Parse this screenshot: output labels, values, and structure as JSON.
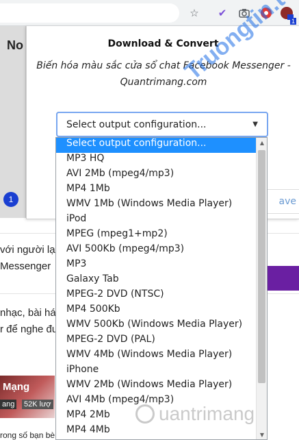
{
  "toolbar": {
    "icons": [
      "star-icon",
      "extension-check-icon",
      "camera-icon",
      "record-icon",
      "profile-icon"
    ],
    "ext_badge": "1"
  },
  "background": {
    "side_title": "No",
    "badge": "1",
    "line1": "với người lạ",
    "line2": "Messenger",
    "line3": "nhạc, bài hát",
    "line4": "r để nghe đư",
    "thumb_title": "Mạng",
    "thumb_views": "52K lượ",
    "thumb_tag": "ang",
    "bottom_line": "rong số bạn bè"
  },
  "popup": {
    "title": "Download & Convert",
    "subtitle": "Biến hóa màu sắc cửa sổ chat Facebook Messenger - Quantrimang.com",
    "save_label": "ave"
  },
  "select": {
    "value": "Select output configuration...",
    "options": [
      "Select output configuration...",
      "MP3 HQ",
      "AVI 2Mb (mpeg4/mp3)",
      "MP4 1Mb",
      "WMV 1Mb (Windows Media Player)",
      "iPod",
      "MPEG (mpeg1+mp2)",
      "AVI 500Kb (mpeg4/mp3)",
      "MP3",
      "Galaxy Tab",
      "MPEG-2 DVD (NTSC)",
      "MP4 500Kb",
      "WMV 500Kb (Windows Media Player)",
      "MPEG-2 DVD (PAL)",
      "WMV 4Mb (Windows Media Player)",
      "iPhone",
      "WMV 2Mb (Windows Media Player)",
      "AVI 4Mb (mpeg4/mp3)",
      "MP4 2Mb",
      "MP4 4Mb"
    ],
    "selected_index": 0
  },
  "watermark": {
    "diagonal": "Truongtin.top",
    "bottom": "uantrimang"
  },
  "colors": {
    "highlight": "#1e90ff",
    "focus_ring": "#78a6f0",
    "purple_banner": "#6a1fa2"
  }
}
